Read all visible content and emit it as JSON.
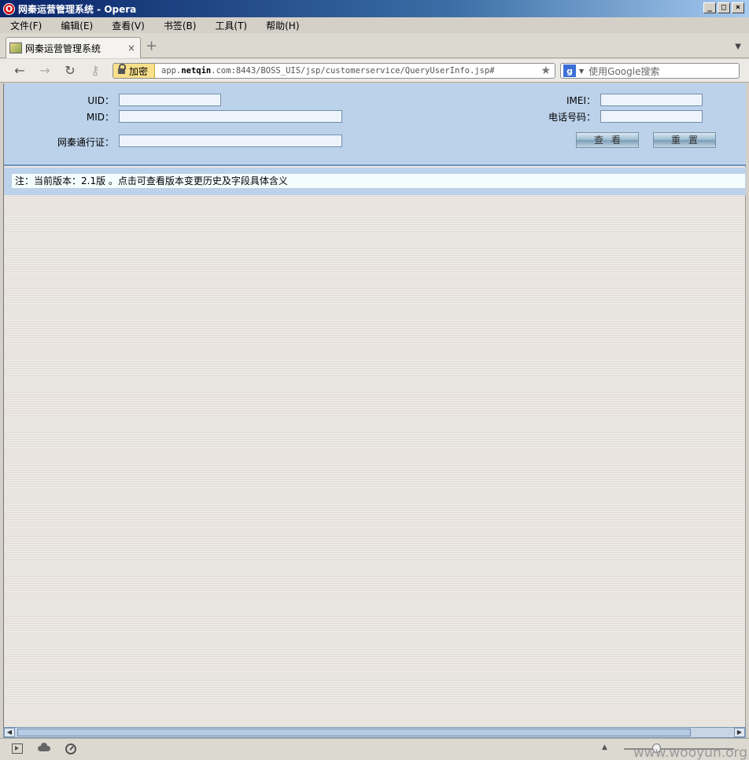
{
  "window": {
    "title": "网秦运营管理系统 - Opera"
  },
  "menu": [
    "文件(F)",
    "编辑(E)",
    "查看(V)",
    "书签(B)",
    "工具(T)",
    "帮助(H)"
  ],
  "tab": {
    "title": "网秦运营管理系统"
  },
  "address": {
    "security_label": "加密",
    "url_prefix": "app.",
    "url_host": "netqin",
    "url_rest": ".com:8443/BOSS_UIS/jsp/customerservice/QueryUserInfo.jsp#"
  },
  "search": {
    "engine": "g",
    "placeholder": "使用Google搜索"
  },
  "form": {
    "uid_label": "UID：",
    "mid_label": "MID：",
    "pass_label": "网秦通行证：",
    "imei_label": "IMEI：",
    "phone_label": "电话号码：",
    "uid_value": "",
    "mid_value": "",
    "pass_value": "",
    "imei_value": "",
    "phone_value": "",
    "query_button": "查看",
    "reset_button": "重置"
  },
  "note": {
    "text": "注：当前版本：2.1版 。点击可查看版本变更历史及字段具体含义"
  },
  "watermark": "www.wooyun.org",
  "colors": {
    "panel_bg": "#bcd2ea",
    "note_bg": "#f4fdfd",
    "title_bar": "#0a246a"
  }
}
